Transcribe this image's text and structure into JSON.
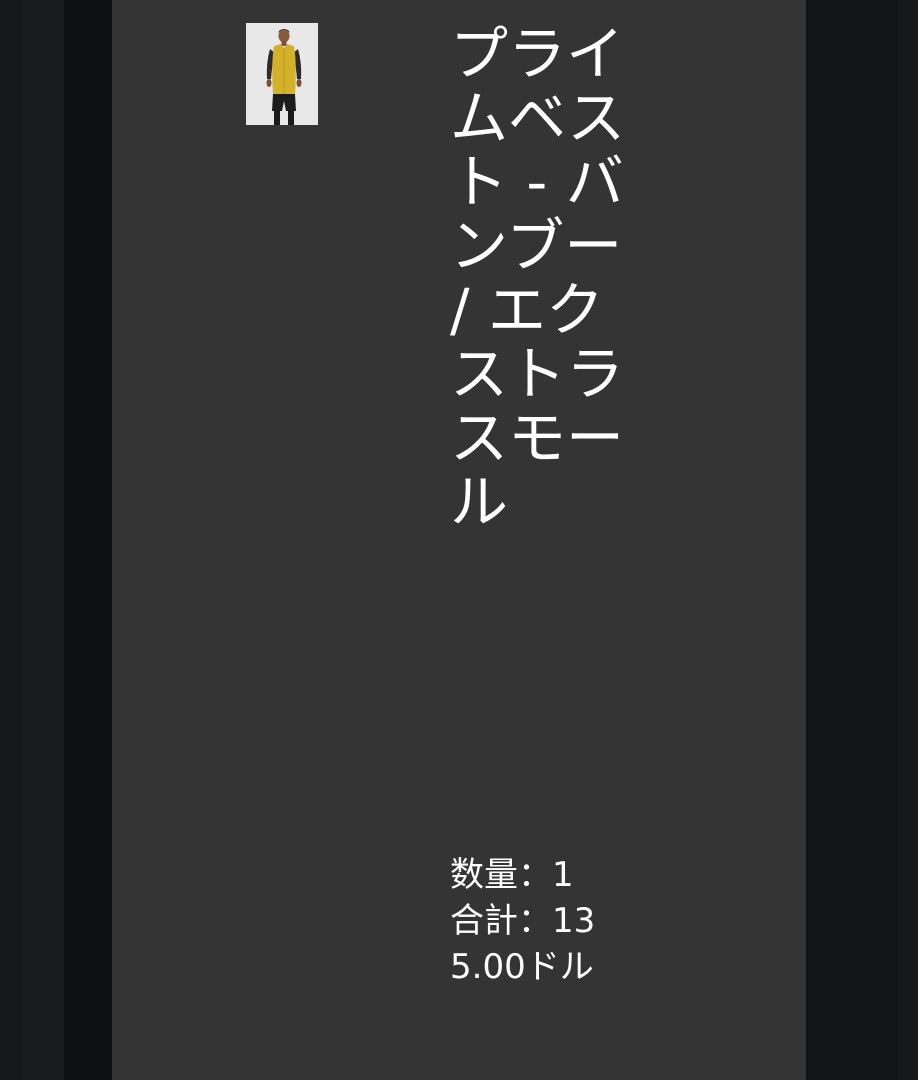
{
  "cart_item": {
    "image_alt": "プライムベスト - バンブー",
    "title": "プライムベスト - バンブー / エクストラスモール",
    "quantity_text": "数量：1",
    "total_text": "合計：135.00ドル"
  },
  "colors": {
    "background": "#141517",
    "panel": "#343434",
    "text": "#ffffff",
    "vest": "#d4b12a"
  }
}
